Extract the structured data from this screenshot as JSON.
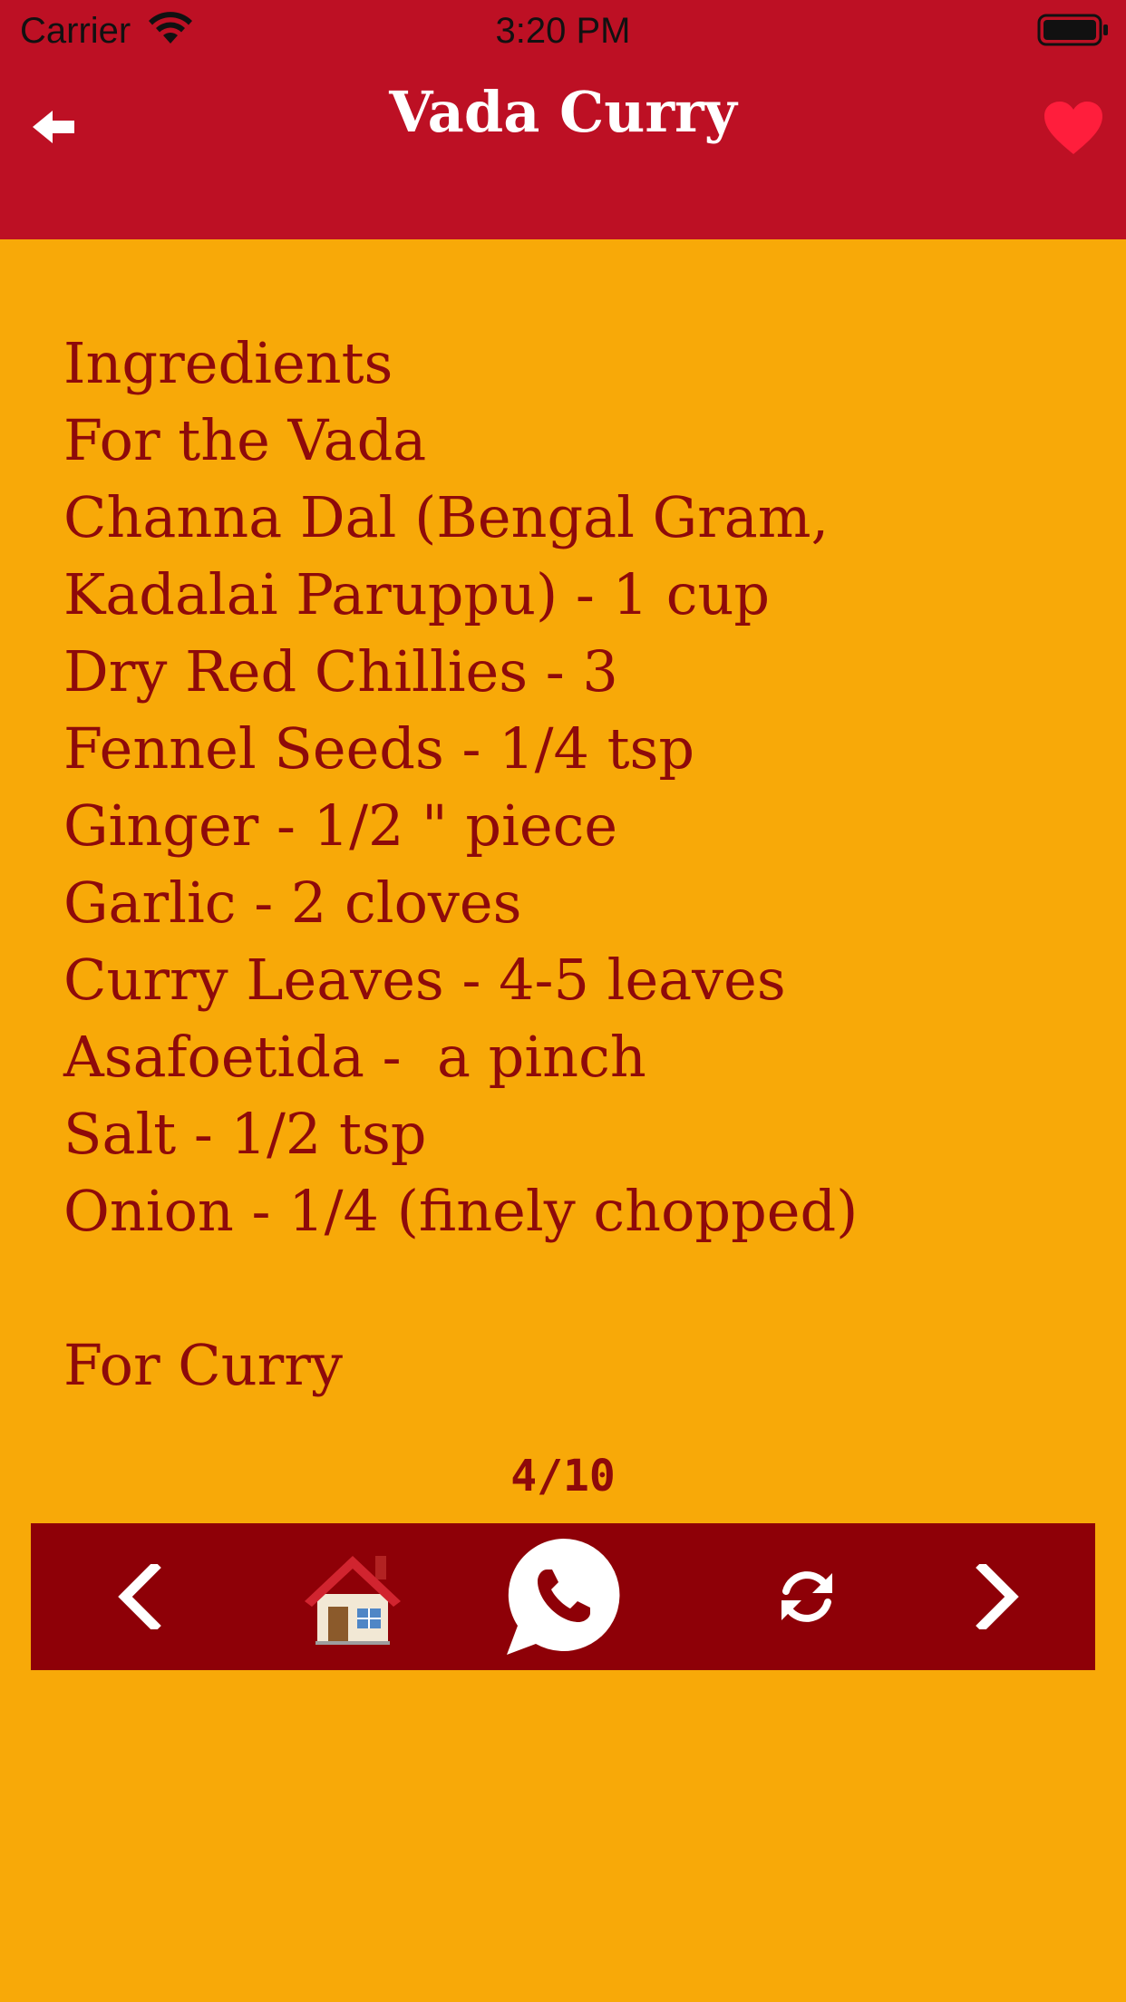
{
  "status_bar": {
    "carrier": "Carrier",
    "time": "3:20 PM"
  },
  "nav": {
    "title": "Vada Curry",
    "back_icon": "back-arrow-icon",
    "favorite_icon": "heart-icon"
  },
  "content": {
    "lines": [
      "Ingredients",
      "For the Vada",
      "Channa Dal (Bengal Gram,",
      "Kadalai Paruppu) - 1 cup",
      "Dry Red Chillies - 3",
      "Fennel Seeds - 1/4 tsp",
      "Ginger - 1/2 \" piece",
      "Garlic - 2 cloves",
      "Curry Leaves - 4-5 leaves",
      "Asafoetida -  a pinch",
      "Salt - 1/2 tsp",
      "Onion - 1/4 (finely chopped)",
      "",
      "For Curry"
    ]
  },
  "pager": {
    "indicator": "4/10"
  },
  "toolbar": {
    "items": [
      "chevron-left-icon",
      "home-icon",
      "whatsapp-icon",
      "refresh-icon",
      "chevron-right-icon"
    ]
  },
  "colors": {
    "header_red": "#BD1024",
    "background_yellow": "#F8A908",
    "text_maroon": "#8E0A0A",
    "toolbar_maroon": "#8E0007",
    "heart_red": "#FF1E3C"
  }
}
